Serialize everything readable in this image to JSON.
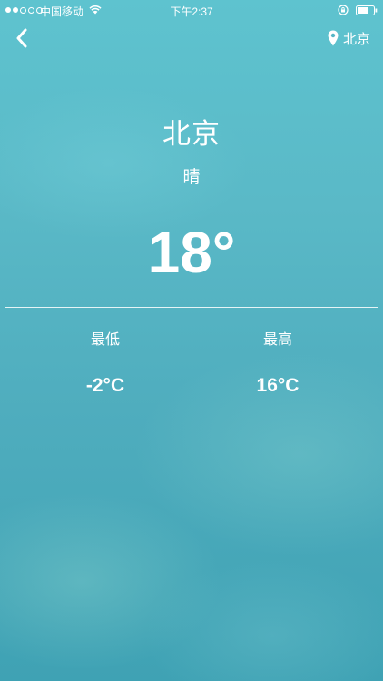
{
  "status_bar": {
    "carrier": "中国移动",
    "time": "下午2:37",
    "signal_bars_filled": 2,
    "signal_bars_total": 5,
    "battery_level_percent": 70
  },
  "nav": {
    "back_icon": "chevron-left-icon",
    "location_icon": "pin-icon",
    "location_label": "北京"
  },
  "weather": {
    "city": "北京",
    "condition": "晴",
    "temperature": "18°",
    "low_label": "最低",
    "low_value": "-2°C",
    "high_label": "最高",
    "high_value": "16°C"
  },
  "colors": {
    "background_top": "#5ec3cf",
    "background_bottom": "#3fa2b4",
    "text": "#ffffff"
  }
}
